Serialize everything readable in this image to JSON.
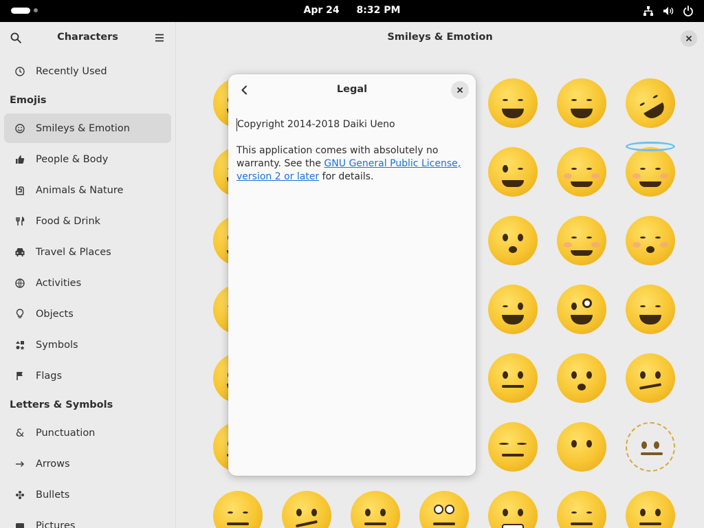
{
  "topbar": {
    "date": "Apr 24",
    "time": "8:32 PM",
    "icons": [
      "network-icon",
      "volume-icon",
      "power-icon"
    ]
  },
  "sidebar": {
    "title": "Characters",
    "recently_used": "Recently Used",
    "emojis_section": "Emojis",
    "emoji_items": [
      {
        "label": "Smileys & Emotion",
        "icon": "smiley-icon",
        "active": true
      },
      {
        "label": "People & Body",
        "icon": "thumbs-up-icon"
      },
      {
        "label": "Animals & Nature",
        "icon": "animal-icon"
      },
      {
        "label": "Food & Drink",
        "icon": "fork-knife-icon"
      },
      {
        "label": "Travel & Places",
        "icon": "car-icon"
      },
      {
        "label": "Activities",
        "icon": "ball-icon"
      },
      {
        "label": "Objects",
        "icon": "lightbulb-icon"
      },
      {
        "label": "Symbols",
        "icon": "symbols-icon"
      },
      {
        "label": "Flags",
        "icon": "flag-icon"
      }
    ],
    "letters_section": "Letters & Symbols",
    "letter_items": [
      {
        "label": "Punctuation",
        "icon": "ampersand-icon"
      },
      {
        "label": "Arrows",
        "icon": "arrow-icon"
      },
      {
        "label": "Bullets",
        "icon": "bullet-icon"
      },
      {
        "label": "Pictures",
        "icon": "picture-icon"
      }
    ]
  },
  "main": {
    "title": "Smileys & Emotion"
  },
  "dialog": {
    "title": "Legal",
    "copyright": "Copyright 2014-2018 Daiki Ueno",
    "license_prefix": "This application comes with absolutely no warranty. See the ",
    "license_link": "GNU General Public License, version 2 or later",
    "license_suffix": " for details."
  }
}
